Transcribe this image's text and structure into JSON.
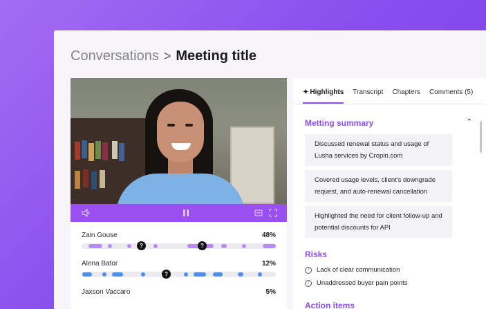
{
  "breadcrumb": {
    "parent": "Conversations",
    "separator": ">",
    "current": "Meeting title"
  },
  "video": {
    "controls": {
      "volume_icon": "speaker-icon",
      "pause_icon": "pause-icon",
      "captions_icon": "captions-icon",
      "fullscreen_icon": "fullscreen-icon"
    }
  },
  "speakers": [
    {
      "name": "Zain Gouse",
      "percent": "48%",
      "color": "#b58cf6"
    },
    {
      "name": "Alena Bator",
      "percent": "12%",
      "color": "#4a90ee"
    },
    {
      "name": "Jaxson Vaccaro",
      "percent": "5%"
    }
  ],
  "tabs": [
    {
      "label": "Highlights",
      "icon": "sparkle-icon",
      "active": true
    },
    {
      "label": "Transcript"
    },
    {
      "label": "Chapters"
    },
    {
      "label": "Comments (5)"
    }
  ],
  "summary": {
    "title": "Metting summary",
    "items": [
      "Discussed renewal status and usage of Lusha services by Cropin.com",
      "Covered  usage levels, client's downgrade request, and auto-renewal cancellation",
      "Highlighted the need for client follow-up and potential discounts for API"
    ]
  },
  "risks": {
    "title": "Risks",
    "items": [
      "Lack of clear communication",
      "Unaddressed buyer pain points"
    ]
  },
  "actions": {
    "title": "Action items"
  },
  "colors": {
    "accent": "#8b4df0",
    "background": "#8a50ee"
  }
}
